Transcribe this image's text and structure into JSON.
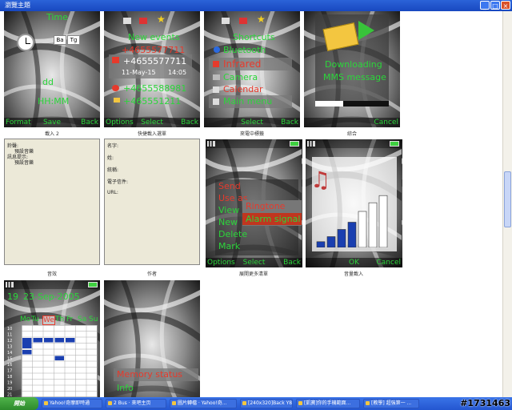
{
  "window": {
    "title": "瀏覽主題"
  },
  "phones": {
    "standby": {
      "time_label": "Time",
      "clock_btn1": "Ba",
      "clock_btn2": "Tg",
      "dd_label": "dd",
      "hh_label": "HH:MM",
      "sk_left": "Format",
      "sk_center": "Save",
      "sk_right": "Back",
      "caption": "載入 2"
    },
    "events": {
      "title": "New events",
      "number1": "+4655577711",
      "number2": "+4655577711",
      "date": "11-May-15",
      "time": "14:05",
      "number3": "+4655588981",
      "number4": "+465551211",
      "sk_left": "Options",
      "sk_center": "Select",
      "sk_right": "Back",
      "caption": "快捷載入選單"
    },
    "shortcuts": {
      "title": "Shortcuts",
      "items": [
        "Bluetooth",
        "Infrared",
        "Camera",
        "Calendar",
        "Main menu"
      ],
      "sk_center": "Select",
      "sk_right": "Back",
      "caption": "來電中標籤"
    },
    "message": {
      "line1": "Downloading",
      "line2": "MMS message",
      "sk_right": "Cancel",
      "caption": "綜合"
    },
    "menu": {
      "items": [
        "Send",
        "Use as",
        "View",
        "New",
        "Delete",
        "Mark"
      ],
      "sub_items": [
        "Ringtone",
        "Alarm signal"
      ],
      "sk_left": "Options",
      "sk_center": "Select",
      "sk_right": "Back",
      "caption": "展開更多清單"
    },
    "volume": {
      "sk_center": "OK",
      "sk_right": "Cancel",
      "caption": "音量載入",
      "levels": [
        0.08,
        0.15,
        0.25,
        0.35,
        0.5,
        0.62,
        0.72
      ]
    },
    "calendar": {
      "day": "19",
      "date": "23-Sep-2005",
      "days": [
        "Mo",
        "Tu",
        "We",
        "Th",
        "Fr",
        "Sa",
        "Su"
      ],
      "hours": [
        "10",
        "11",
        "12",
        "13",
        "14",
        "15",
        "16",
        "17",
        "18",
        "19",
        "20",
        "21"
      ]
    },
    "memory": {
      "item1": "Memory status",
      "item2": "Info"
    }
  },
  "panels": {
    "sound": {
      "lines": [
        "鈴聲:",
        "預設音樂",
        "訊息提示:",
        "預設音樂"
      ],
      "caption": "音效"
    },
    "author": {
      "lines": [
        "名字:",
        "姓:",
        "統稱:",
        "電子信件:",
        "URL:"
      ],
      "caption": "作者"
    }
  },
  "taskbar": {
    "start": "開始",
    "tasks": [
      "Yahoo!奇摩即時通",
      "2 Bus · 來吧主页",
      "圖片轉檔 · Yahoo!奇...",
      "[240x320]Back Y8 ...",
      "[凱寶]你的手機範面...",
      "[教學] 超強第一 ..."
    ]
  },
  "watermark": "#1731463",
  "colors": {
    "accent_green": "#2bd53a",
    "accent_red": "#e63a2c",
    "highlight_red": "#c0361f"
  },
  "icons": [
    "clock-icon",
    "folder-icon",
    "envelope-icon",
    "send-icon",
    "bluetooth-icon",
    "infrared-icon",
    "camera-icon",
    "calendar-icon",
    "menu-icon",
    "note-icon",
    "signal-icon",
    "battery-icon"
  ]
}
